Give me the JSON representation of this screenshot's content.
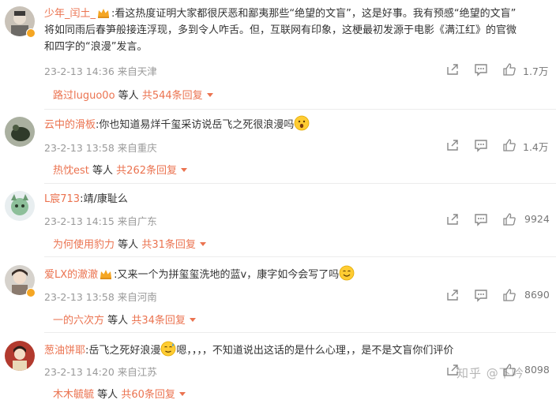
{
  "comments": [
    {
      "user": "少年_闰土_",
      "body_l1": ":看这热度证明大家都很厌恶和鄙夷那些“绝望的文盲”，这是好事。我有预感“绝望的文盲”",
      "body_l2": "将如同雨后春笋般接连浮现，多到令人咋舌。但，互联网有印象，这梗最初发源于电影《满江红》的官微",
      "body_l3": "和四字的“浪漫”发言。",
      "time": "23-2-13 14:36",
      "location": "来自天津",
      "likes": "1.7万",
      "reply_user": "路过luguo0o",
      "reply_mid": "等人",
      "reply_count": "共544条回复"
    },
    {
      "user": "云中的滑板",
      "body_l1": ":你也知道易烊千玺采访说岳飞之死很浪漫吗",
      "time": "23-2-13 13:58",
      "location": "来自重庆",
      "likes": "1.4万",
      "reply_user": "热忱est",
      "reply_mid": "等人",
      "reply_count": "共262条回复"
    },
    {
      "user": "L宸713",
      "body_l1": ":靖/康耻么",
      "time": "23-2-13 14:15",
      "location": "来自广东",
      "likes": "9924",
      "reply_user": "为何使用豹力",
      "reply_mid": "等人",
      "reply_count": "共31条回复"
    },
    {
      "user": "爱LX的澈澈",
      "body_l1": ":又来一个为拼玺玺洗地的蓝v，康字如今会写了吗",
      "time": "23-2-13 13:58",
      "location": "来自河南",
      "likes": "8690",
      "reply_user": "一的六次方",
      "reply_mid": "等人",
      "reply_count": "共34条回复"
    },
    {
      "user": "葱油饼耶",
      "body_l1": ":岳飞之死好浪漫",
      "body_l1b": "嗯，，，，不知道说出这话的是什么心理，，是不是文盲你们评价",
      "time": "23-2-13 14:20",
      "location": "来自江苏",
      "likes": "8098",
      "reply_user": "木木毓毓",
      "reply_mid": "等人",
      "reply_count": "共60条回复"
    }
  ],
  "watermark": "知乎 @下吟",
  "colors": {
    "accent": "#eb7350",
    "meta": "#999999",
    "vip": "#f5a623"
  },
  "icons": [
    "share-icon",
    "comment-icon",
    "like-icon",
    "crown-icon",
    "chevron-down-icon"
  ]
}
